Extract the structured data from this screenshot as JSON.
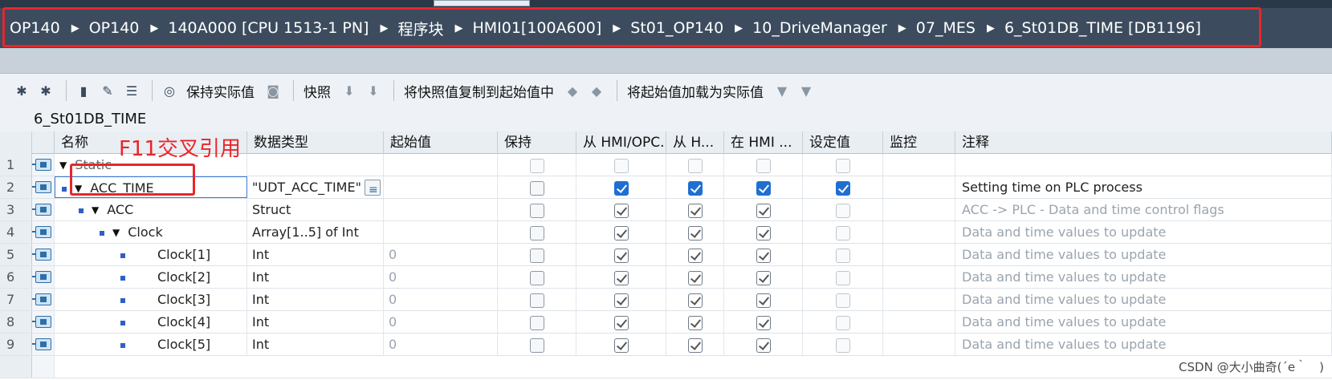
{
  "breadcrumb": [
    "OP140",
    "OP140",
    "140A000 [CPU 1513-1 PN]",
    "程序块",
    "HMI01[100A600]",
    "St01_OP140",
    "10_DriveManager",
    "07_MES",
    "6_St01DB_TIME [DB1196]"
  ],
  "toolbar": {
    "keep_actual": "保持实际值",
    "snapshot": "快照",
    "copy_snapshot": "将快照值复制到起始值中",
    "load_start": "将起始值加载为实际值"
  },
  "block_name": "6_St01DB_TIME",
  "columns": {
    "name": "名称",
    "datatype": "数据类型",
    "start": "起始值",
    "retain": "保持",
    "from_hmi_opc": "从 HMI/OPC...",
    "from_h": "从 H...",
    "in_hmi": "在 HMI ...",
    "setpoint": "设定值",
    "monitor": "监控",
    "comment": "注释"
  },
  "rows": [
    {
      "num": "1",
      "name": "Static",
      "type": "",
      "start": "",
      "comment": ""
    },
    {
      "num": "2",
      "name": "ACC_TIME",
      "type": "\"UDT_ACC_TIME\"",
      "start": "",
      "comment": "Setting time on PLC process"
    },
    {
      "num": "3",
      "name": "ACC",
      "type": "Struct",
      "start": "",
      "comment": "ACC -> PLC - Data and time control flags"
    },
    {
      "num": "4",
      "name": "Clock",
      "type": "Array[1..5] of Int",
      "start": "",
      "comment": "Data and time values to update"
    },
    {
      "num": "5",
      "name": "Clock[1]",
      "type": "Int",
      "start": "0",
      "comment": "Data and time values to update"
    },
    {
      "num": "6",
      "name": "Clock[2]",
      "type": "Int",
      "start": "0",
      "comment": "Data and time values to update"
    },
    {
      "num": "7",
      "name": "Clock[3]",
      "type": "Int",
      "start": "0",
      "comment": "Data and time values to update"
    },
    {
      "num": "8",
      "name": "Clock[4]",
      "type": "Int",
      "start": "0",
      "comment": "Data and time values to update"
    },
    {
      "num": "9",
      "name": "Clock[5]",
      "type": "Int",
      "start": "0",
      "comment": "Data and time values to update"
    }
  ],
  "annotation": "F11交叉引用",
  "watermark": "CSDN @大小曲奇(´e｀　)"
}
